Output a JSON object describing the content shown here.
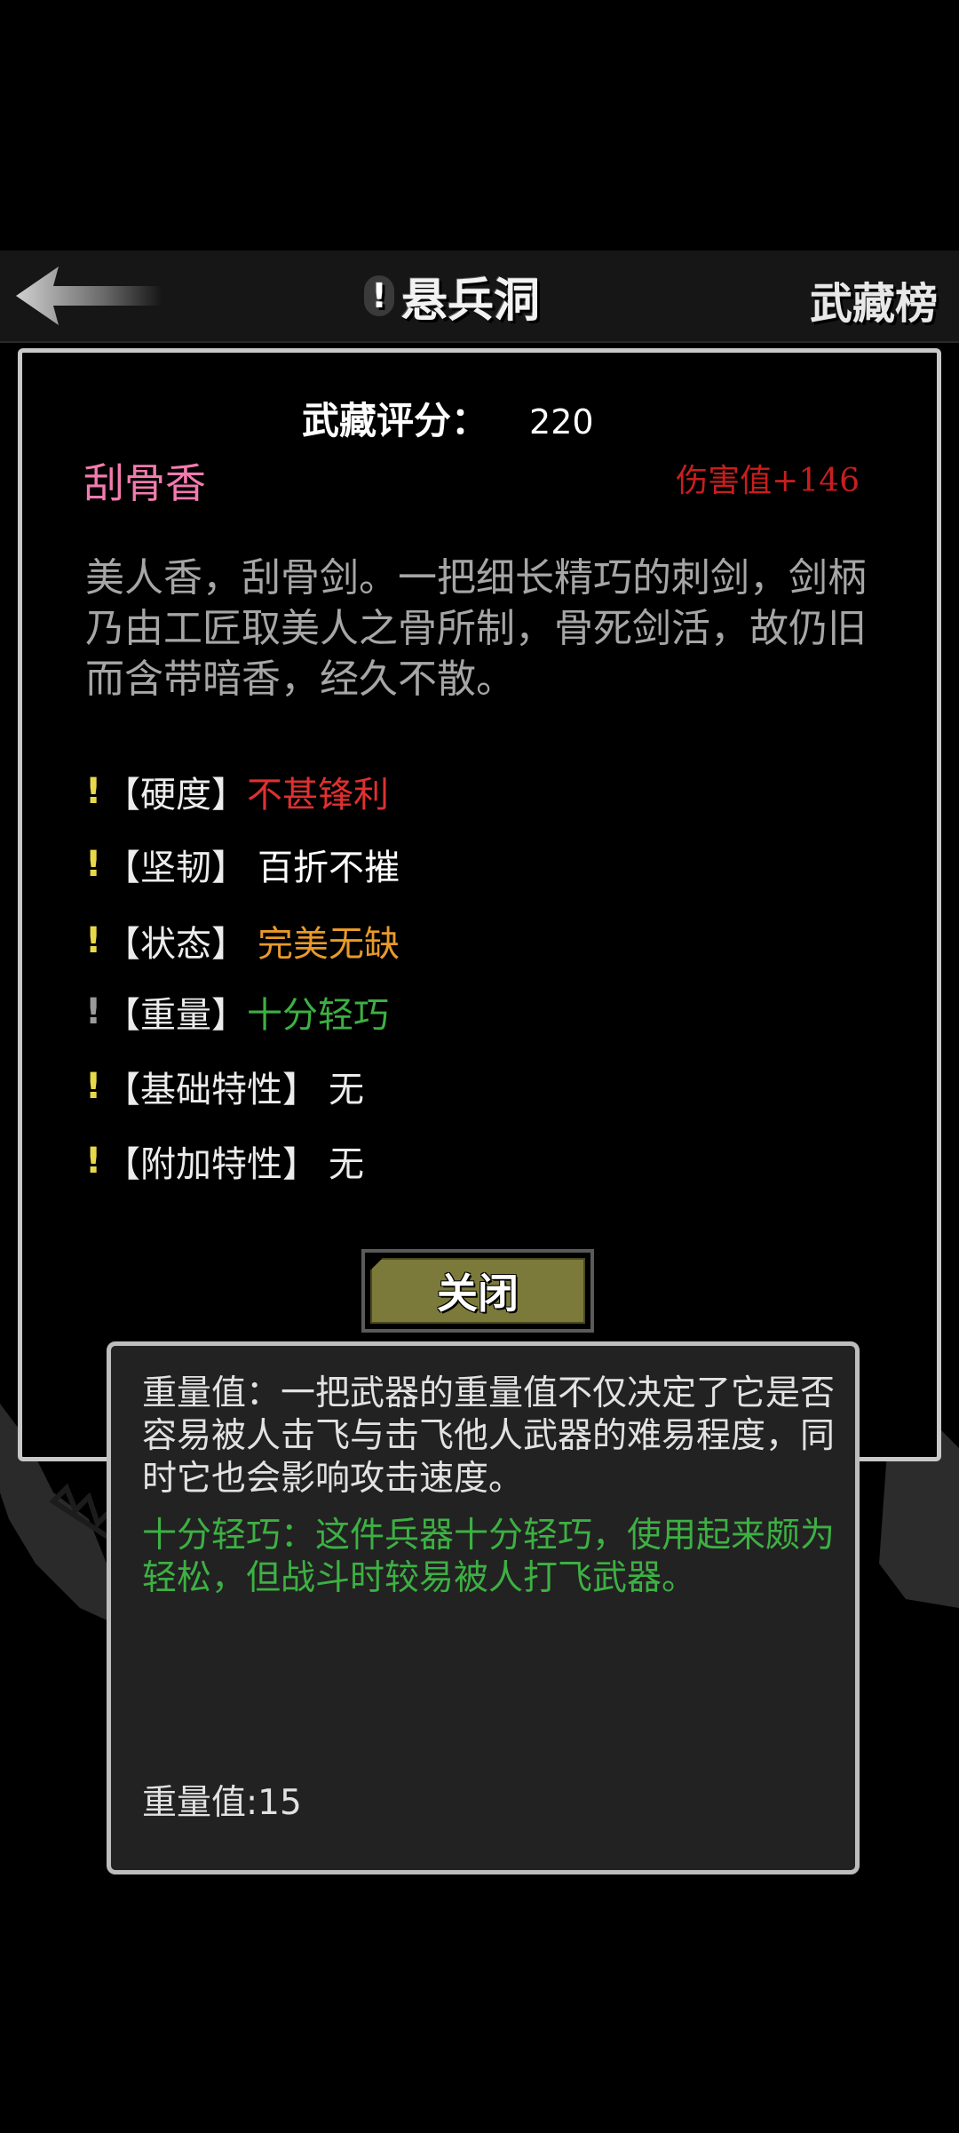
{
  "header": {
    "back_label": "",
    "title_mark": "!",
    "title": "悬兵洞",
    "rank_label": "武藏榜"
  },
  "weapon": {
    "score_label": "武藏评分：",
    "score_value": "220",
    "name": "刮骨香",
    "damage": "伤害值+146",
    "description": "美人香，刮骨剑。一把细长精巧的刺剑，剑柄乃由工匠取美人之骨所制，骨死剑活，故仍旧而含带暗香，经久不散。",
    "attributes": [
      {
        "mark": "!",
        "label": "【硬度】",
        "value": "不甚锋利"
      },
      {
        "mark": "!",
        "label": "【坚韧】",
        "value": "百折不摧"
      },
      {
        "mark": "!",
        "label": "【状态】",
        "value": "完美无缺"
      },
      {
        "mark": "!",
        "label": "【重量】",
        "value": "十分轻巧"
      },
      {
        "mark": "!",
        "label": "【基础特性】",
        "value": "无"
      },
      {
        "mark": "!",
        "label": "【附加特性】",
        "value": "无"
      }
    ],
    "close_label": "关闭"
  },
  "tooltip": {
    "description": "重量值：一把武器的重量值不仅决定了它是否容易被人击飞与击飞他人武器的难易程度，同时它也会影响攻击速度。",
    "effect": "十分轻巧：这件兵器十分轻巧，使用起来颇为轻松，但战斗时较易被人打飞武器。",
    "value_text": "重量值:15"
  },
  "colors": {
    "name": "#f27bb0",
    "damage": "#c81e1e",
    "attr_bang": "#e8d94a",
    "attr_bang_muted": "#9a9a9a",
    "hardness": "#e03030",
    "toughness": "#ffffff",
    "condition": "#e89a2a",
    "weight": "#3db043",
    "tooltip_effect": "#3db043",
    "close_button": "#7c7a3a"
  }
}
